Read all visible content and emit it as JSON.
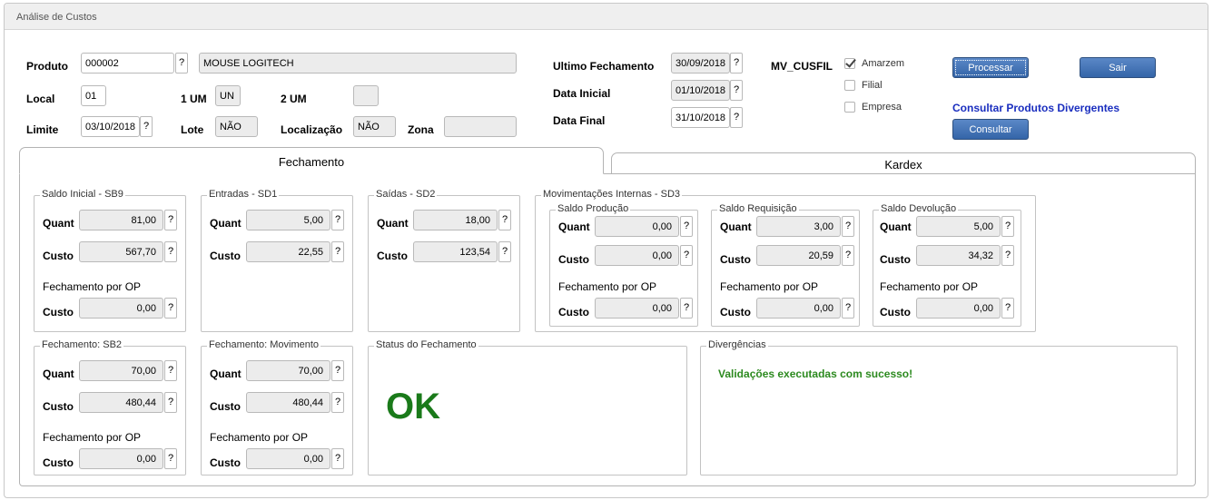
{
  "window": {
    "title": "Análise de Custos"
  },
  "header": {
    "produto": {
      "label": "Produto",
      "code": "000002",
      "description": "MOUSE LOGITECH"
    },
    "local": {
      "label": "Local",
      "value": "01"
    },
    "um1": {
      "label": "1 UM",
      "value": "UN"
    },
    "um2": {
      "label": "2 UM",
      "value": ""
    },
    "limite": {
      "label": "Limite",
      "value": "03/10/2018"
    },
    "lote": {
      "label": "Lote",
      "value": "NÃO"
    },
    "localizacao": {
      "label": "Localização",
      "value": "NÃO"
    },
    "zona": {
      "label": "Zona",
      "value": ""
    },
    "ultimo_fechamento": {
      "label": "Ultimo Fechamento",
      "value": "30/09/2018"
    },
    "data_inicial": {
      "label": "Data Inicial",
      "value": "01/10/2018"
    },
    "data_final": {
      "label": "Data Final",
      "value": "31/10/2018"
    },
    "mv_cusfil": {
      "label": "MV_CUSFIL"
    },
    "options": [
      {
        "label": "Amarzem",
        "checked": true
      },
      {
        "label": "Filial",
        "checked": false
      },
      {
        "label": "Empresa",
        "checked": false
      }
    ],
    "processar_label": "Processar",
    "sair_label": "Sair",
    "consultar_divergentes_label": "Consultar Produtos Divergentes",
    "consultar_label": "Consultar",
    "help_label": "?"
  },
  "tabs": [
    {
      "label": "Fechamento",
      "active": true
    },
    {
      "label": "Kardex",
      "active": false
    }
  ],
  "fields": {
    "quant": "Quant",
    "custo": "Custo",
    "fech_op": "Fechamento por OP"
  },
  "groups": {
    "saldo_inicial": {
      "title": "Saldo Inicial - SB9",
      "quant": "81,00",
      "custo": "567,70",
      "op_custo": "0,00"
    },
    "entradas": {
      "title": "Entradas - SD1",
      "quant": "5,00",
      "custo": "22,55"
    },
    "saidas": {
      "title": "Saídas - SD2",
      "quant": "18,00",
      "custo": "123,54"
    },
    "mov_internas": {
      "title": "Movimentações Internas - SD3"
    },
    "saldo_producao": {
      "title": "Saldo Produção",
      "quant": "0,00",
      "custo": "0,00",
      "op_custo": "0,00"
    },
    "saldo_requisicao": {
      "title": "Saldo Requisição",
      "quant": "3,00",
      "custo": "20,59",
      "op_custo": "0,00"
    },
    "saldo_devolucao": {
      "title": "Saldo Devolução",
      "quant": "5,00",
      "custo": "34,32",
      "op_custo": "0,00"
    },
    "fechamento_sb2": {
      "title": "Fechamento: SB2",
      "quant": "70,00",
      "custo": "480,44",
      "op_custo": "0,00"
    },
    "fechamento_mov": {
      "title": "Fechamento: Movimento",
      "quant": "70,00",
      "custo": "480,44",
      "op_custo": "0,00"
    },
    "status": {
      "title": "Status do Fechamento",
      "value": "OK"
    },
    "divergencias": {
      "title": "Divergências",
      "message": "Validações executadas com sucesso!"
    }
  }
}
